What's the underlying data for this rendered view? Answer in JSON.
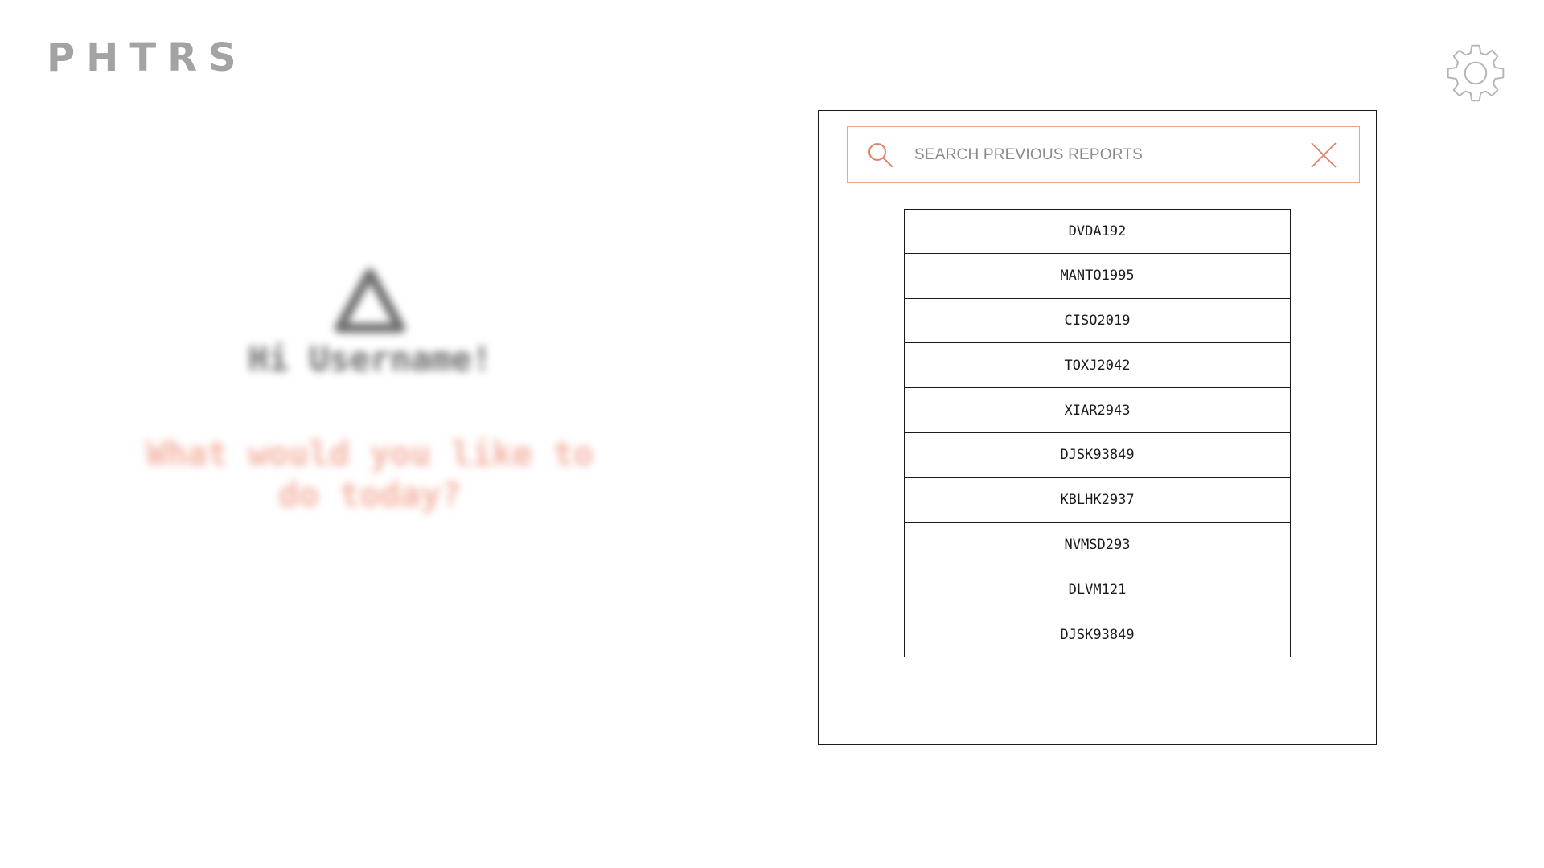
{
  "logo": {
    "text": "PHTRS"
  },
  "settings": {
    "icon": "gear-icon"
  },
  "welcome": {
    "icon": "triangle-icon",
    "greeting": "Hi Username!",
    "question": "What would you like to do today?"
  },
  "search": {
    "icon": "search-icon",
    "placeholder": "SEARCH PREVIOUS REPORTS",
    "value": "",
    "close_icon": "close-icon"
  },
  "reports": [
    {
      "id": "DVDA192"
    },
    {
      "id": "MANTO1995"
    },
    {
      "id": "CISO2019"
    },
    {
      "id": "TOXJ2042"
    },
    {
      "id": "XIAR2943"
    },
    {
      "id": "DJSK93849"
    },
    {
      "id": "KBLHK2937"
    },
    {
      "id": "NVMSD293"
    },
    {
      "id": "DLVM121"
    },
    {
      "id": "DJSK93849"
    }
  ],
  "colors": {
    "accent": "#e8a792",
    "logo": "#a3a3a3",
    "question": "#f3b4a4",
    "border": "#1a1a1a"
  }
}
